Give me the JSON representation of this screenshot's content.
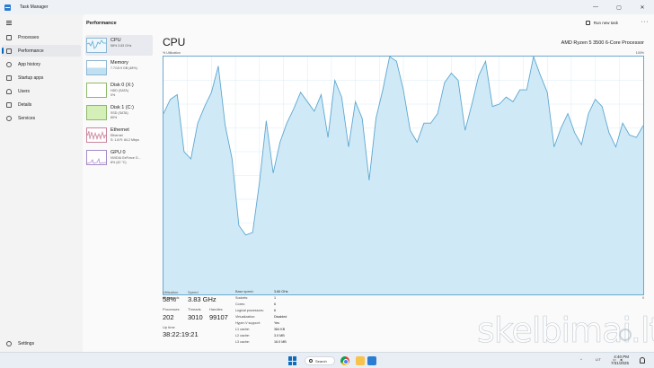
{
  "window": {
    "title": "Task Manager",
    "controls": [
      "—",
      "▢",
      "✕"
    ]
  },
  "sidebar": {
    "items": [
      {
        "label": "Processes",
        "icon": "grid-icon"
      },
      {
        "label": "Performance",
        "icon": "performance-icon"
      },
      {
        "label": "App history",
        "icon": "history-icon"
      },
      {
        "label": "Startup apps",
        "icon": "startup-icon"
      },
      {
        "label": "Users",
        "icon": "users-icon"
      },
      {
        "label": "Details",
        "icon": "list-icon"
      },
      {
        "label": "Services",
        "icon": "services-icon"
      }
    ],
    "settings_label": "Settings"
  },
  "header": {
    "title": "Performance",
    "run_task": "Run new task",
    "more": "···"
  },
  "resources": [
    {
      "title": "CPU",
      "lines": [
        "58% 3.83 GHz"
      ]
    },
    {
      "title": "Memory",
      "lines": [
        "7.7/15.9 GB (48%)"
      ]
    },
    {
      "title": "Disk 0 (X:)",
      "lines": [
        "HDD (SATA)",
        "0%"
      ]
    },
    {
      "title": "Disk 1 (C:)",
      "lines": [
        "SSD (SATA)",
        "80%"
      ]
    },
    {
      "title": "Ethernet",
      "lines": [
        "Ethernet",
        "S: 1.8 R: 84.2 Mbps"
      ]
    },
    {
      "title": "GPU 0",
      "lines": [
        "NVIDIA GeForce G...",
        "8% (42 °C)"
      ]
    }
  ],
  "cpu": {
    "title": "CPU",
    "model": "AMD Ryzen 5 3500 6-Core Processor",
    "axis_label": "% Utilization",
    "axis_max": "100%",
    "axis_time": "60 seconds",
    "axis_min": "0",
    "utilization_label": "Utilization",
    "utilization": "58%",
    "speed_label": "Speed",
    "speed": "3.83 GHz",
    "processes_label": "Processes",
    "processes": "202",
    "threads_label": "Threads",
    "threads": "3010",
    "handles_label": "Handles",
    "handles": "99107",
    "uptime_label": "Up time",
    "uptime": "38:22:19:21",
    "specs": [
      {
        "label": "Base speed:",
        "value": "3.60 GHz"
      },
      {
        "label": "Sockets:",
        "value": "1"
      },
      {
        "label": "Cores:",
        "value": "6"
      },
      {
        "label": "Logical processors:",
        "value": "6"
      },
      {
        "label": "Virtualization:",
        "value": "Disabled"
      },
      {
        "label": "Hyper-V support:",
        "value": "Yes"
      },
      {
        "label": "L1 cache:",
        "value": "384 KB"
      },
      {
        "label": "L2 cache:",
        "value": "3.0 MB"
      },
      {
        "label": "L3 cache:",
        "value": "16.0 MB"
      }
    ],
    "history": [
      76,
      82,
      84,
      60,
      57,
      72,
      79,
      85,
      96,
      71,
      57,
      29,
      25,
      26,
      47,
      73,
      51,
      64,
      72,
      78,
      85,
      81,
      77,
      84,
      66,
      90,
      83,
      62,
      81,
      74,
      48,
      74,
      86,
      101,
      98,
      86,
      69,
      64,
      72,
      72,
      76,
      89,
      93,
      90,
      69,
      80,
      92,
      98,
      79,
      80,
      83,
      81,
      86,
      86,
      101,
      92,
      85,
      62,
      70,
      76,
      68,
      63,
      76,
      82,
      79,
      68,
      62,
      72,
      67,
      66,
      71
    ]
  },
  "taskbar": {
    "search_label": "Search",
    "tray_lang": "LIT",
    "time": "4:40 PM",
    "date": "7/31/2025"
  },
  "watermark": "skelbimai.lt",
  "colors": {
    "accent": "#0067c0",
    "chart_line": "#5fa7d1",
    "chart_fill": "#cfeaf6",
    "chart_grid": "#d9ecf6"
  }
}
